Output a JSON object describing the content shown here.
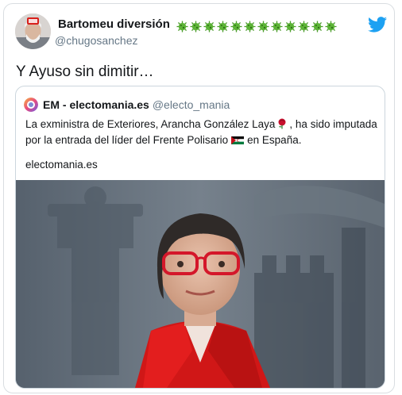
{
  "tweet": {
    "author_name": "Bartomeu diversión",
    "author_handle": "@chugosanchez",
    "author_emoji_icons": [
      "virus-icon",
      "virus-icon",
      "virus-icon",
      "virus-icon",
      "virus-icon",
      "virus-icon",
      "virus-icon",
      "virus-icon",
      "virus-icon",
      "virus-icon",
      "virus-icon",
      "virus-icon"
    ],
    "text": "Y Ayuso sin dimitir…",
    "platform_icon": "twitter-bird-icon",
    "accent_color": "#1da1f2"
  },
  "quote": {
    "account_name": "EM - electomania.es",
    "account_handle": "@electo_mania",
    "text_part1": "La exministra de Exteriores, Arancha González Laya",
    "text_part2": ", ha sido imputada por la entrada del líder del Frente Polisario",
    "text_part3": "en España.",
    "link": "electomania.es",
    "inline_icons": [
      "rose-icon",
      "sahrawi-flag-icon"
    ],
    "photo": "woman-red-glasses-photo"
  }
}
